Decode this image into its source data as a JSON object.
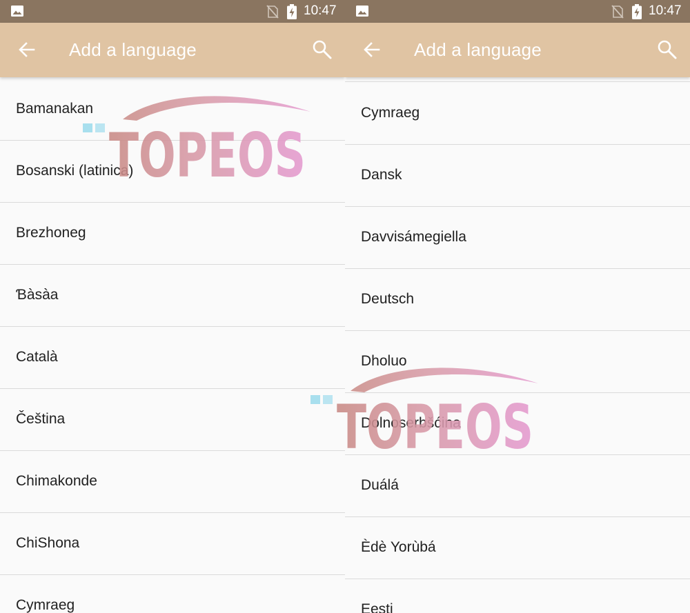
{
  "status_bar": {
    "time": "10:47",
    "icons": [
      "image-icon",
      "no-sim-icon",
      "battery-charging-icon"
    ]
  },
  "app_bar": {
    "title": "Add a language",
    "back_icon": "arrow-back-icon",
    "search_icon": "search-icon"
  },
  "watermark": {
    "text": "TOPEOS"
  },
  "screens": {
    "left": {
      "items": [
        "Bamanakan",
        "Bosanski (latinica)",
        "Brezhoneg",
        "Ɓàsàa",
        "Català",
        "Čeština",
        "Chimakonde",
        "ChiShona",
        "Cymraeg"
      ]
    },
    "right": {
      "items": [
        "Cymraeg",
        "Dansk",
        "Davvisámegiella",
        "Deutsch",
        "Dholuo",
        "Dolnoserbšćina",
        "Duálá",
        "Èdè Yorùbá",
        "Eesti"
      ]
    }
  },
  "colors": {
    "status_bar": "#8a7560",
    "app_bar": "#e0c4a3",
    "list_bg": "#fafafa",
    "divider": "#dadada",
    "text": "#212121"
  }
}
